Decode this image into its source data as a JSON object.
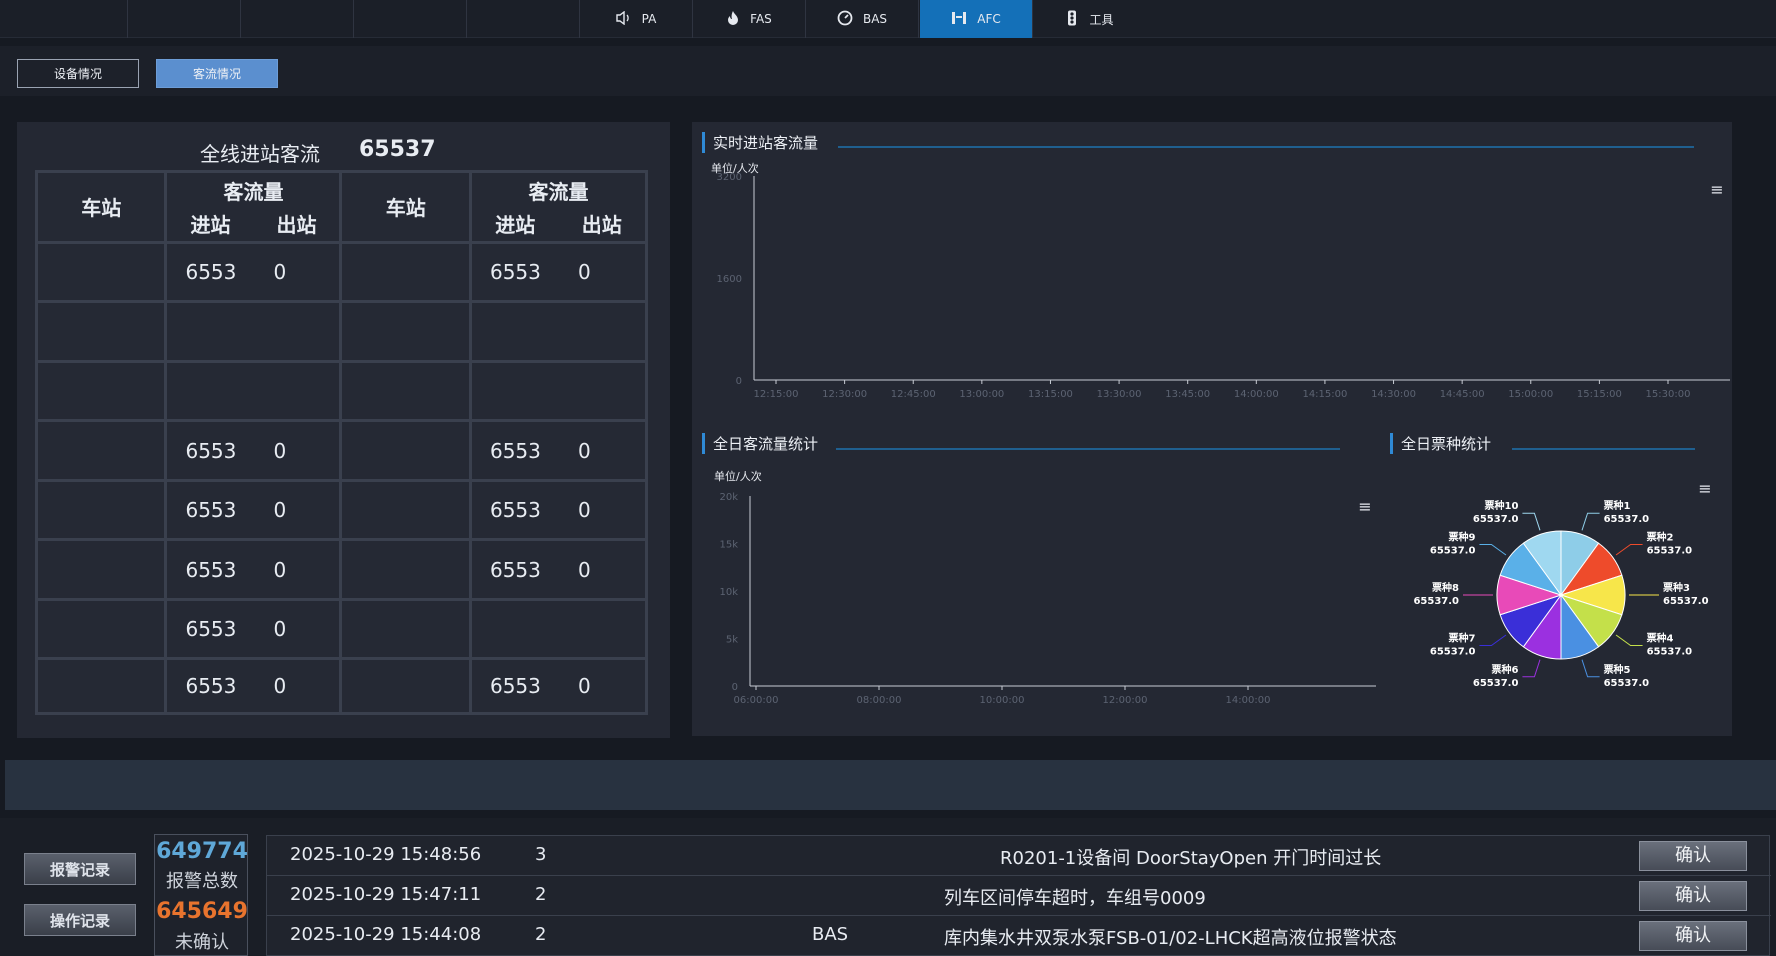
{
  "nav": {
    "items": [
      {
        "label": "PA",
        "icon": "speaker-icon",
        "glyph": "🔈"
      },
      {
        "label": "FAS",
        "icon": "fire-icon",
        "glyph": "🔥"
      },
      {
        "label": "BAS",
        "icon": "gauge-icon",
        "glyph": "◔"
      },
      {
        "label": "AFC",
        "icon": "gate-icon",
        "glyph": "⎕"
      },
      {
        "label": "工具",
        "icon": "traffic-light-icon",
        "glyph": "≡"
      }
    ],
    "active": "AFC"
  },
  "subtabs": {
    "equipment": "设备情况",
    "passenger": "客流情况",
    "active": "客流情况"
  },
  "left": {
    "total_label": "全线进站客流",
    "total_value": "65537",
    "headers": {
      "station": "车站",
      "flow": "客流量",
      "in": "进站",
      "out": "出站"
    },
    "rows": [
      {
        "l_in": "6553",
        "l_out": "0",
        "r_in": "6553",
        "r_out": "0"
      },
      {
        "l_in": "",
        "l_out": "",
        "r_in": "",
        "r_out": ""
      },
      {
        "l_in": "",
        "l_out": "",
        "r_in": "",
        "r_out": ""
      },
      {
        "l_in": "6553",
        "l_out": "0",
        "r_in": "6553",
        "r_out": "0"
      },
      {
        "l_in": "6553",
        "l_out": "0",
        "r_in": "6553",
        "r_out": "0"
      },
      {
        "l_in": "6553",
        "l_out": "0",
        "r_in": "6553",
        "r_out": "0"
      },
      {
        "l_in": "6553",
        "l_out": "0",
        "r_in": "",
        "r_out": ""
      },
      {
        "l_in": "6553",
        "l_out": "0",
        "r_in": "6553",
        "r_out": "0"
      }
    ]
  },
  "chart_data": [
    {
      "type": "line",
      "title": "实时进站客流量",
      "ylabel": "单位/人次",
      "yticks": [
        "3200",
        "1600",
        "0"
      ],
      "ylim": [
        0,
        3200
      ],
      "x": [
        "12:15:00",
        "12:30:00",
        "12:45:00",
        "13:00:00",
        "13:15:00",
        "13:30:00",
        "13:45:00",
        "14:00:00",
        "14:15:00",
        "14:30:00",
        "14:45:00",
        "15:00:00",
        "15:15:00",
        "15:30:00"
      ],
      "series": [],
      "grid": false
    },
    {
      "type": "bar",
      "title": "全日客流量统计",
      "ylabel": "单位/人次",
      "yticks": [
        "20k",
        "15k",
        "10k",
        "5k",
        "0"
      ],
      "ylim": [
        0,
        20000
      ],
      "x": [
        "06:00:00",
        "08:00:00",
        "10:00:00",
        "12:00:00",
        "14:00:00"
      ],
      "series": [],
      "grid": false
    },
    {
      "type": "pie",
      "title": "全日票种统计",
      "slices": [
        {
          "label": "票种1",
          "value": "65537.0",
          "color": "#8ecde8"
        },
        {
          "label": "票种2",
          "value": "65537.0",
          "color": "#ee4b2b"
        },
        {
          "label": "票种3",
          "value": "65537.0",
          "color": "#f7e64a"
        },
        {
          "label": "票种4",
          "value": "65537.0",
          "color": "#c4e04a"
        },
        {
          "label": "票种5",
          "value": "65537.0",
          "color": "#4a90e2"
        },
        {
          "label": "票种6",
          "value": "65537.0",
          "color": "#9b30e0"
        },
        {
          "label": "票种7",
          "value": "65537.0",
          "color": "#3a2fd8"
        },
        {
          "label": "票种8",
          "value": "65537.0",
          "color": "#e84ab8"
        },
        {
          "label": "票种9",
          "value": "65537.0",
          "color": "#5ab0e8"
        },
        {
          "label": "票种10",
          "value": "65537.0",
          "color": "#9fd8f0"
        }
      ]
    }
  ],
  "bottom": {
    "alarm_log": "报警记录",
    "op_log": "操作记录",
    "total_count": "649774",
    "total_label": "报警总数",
    "unconfirmed_count": "645649",
    "unconfirmed_label": "未确认",
    "colors": {
      "total": "#5fa8d8",
      "unconfirmed": "#e8742e"
    },
    "alarms": [
      {
        "time": "2025-10-29 15:48:56",
        "level": "3",
        "system": "",
        "message": "R0201-1设备间 DoorStayOpen 开门时间过长",
        "action": "确认"
      },
      {
        "time": "2025-10-29 15:47:11",
        "level": "2",
        "system": "",
        "message": "列车区间停车超时，车组号0009",
        "action": "确认"
      },
      {
        "time": "2025-10-29 15:44:08",
        "level": "2",
        "system": "BAS",
        "message": "库内集水井双泵水泵FSB-01/02-LHCK超高液位报警状态",
        "action": "确认"
      }
    ]
  }
}
